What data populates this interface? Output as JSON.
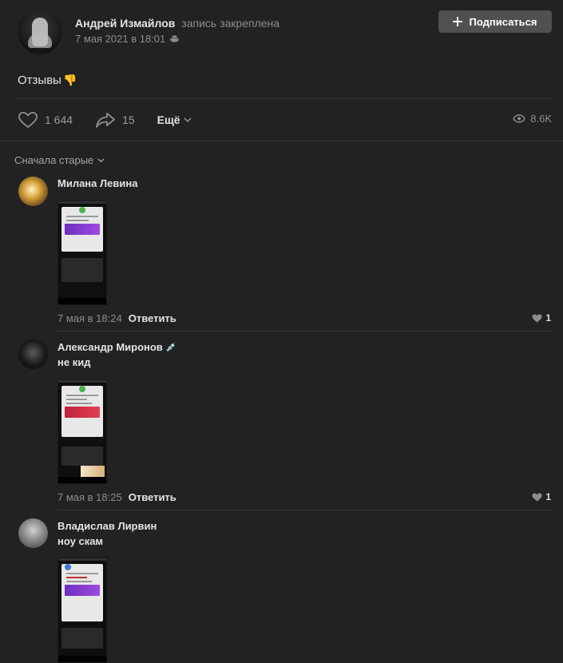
{
  "post": {
    "author_name": "Андрей Измайлов",
    "pinned_label": "запись закреплена",
    "date": "7 мая 2021 в 18:01",
    "platform_icon": "android-icon",
    "subscribe_label": "Подписаться",
    "text": "Отзывы",
    "emoji": "👎"
  },
  "actions": {
    "likes": "1 644",
    "shares": "15",
    "more_label": "Ещё",
    "views": "8.6K"
  },
  "sort_label": "Сначала старые",
  "comments": [
    {
      "author": "Милана Левина",
      "text": "",
      "time": "7 мая в 18:24",
      "reply_label": "Ответить",
      "likes": "1",
      "avatar_color": "#c99a3a"
    },
    {
      "author": "Александр Миронов",
      "author_emoji": "💉",
      "text": "не кид",
      "time": "7 мая в 18:25",
      "reply_label": "Ответить",
      "likes": "1",
      "avatar_color": "#1a1a1a"
    },
    {
      "author": "Владислав Лирвин",
      "text": "ноу скам",
      "avatar_color": "#8a8a8a"
    }
  ],
  "colors": {
    "background": "#222222",
    "divider": "#363738",
    "button": "#505050",
    "secondary_text": "#8d8d8d"
  }
}
